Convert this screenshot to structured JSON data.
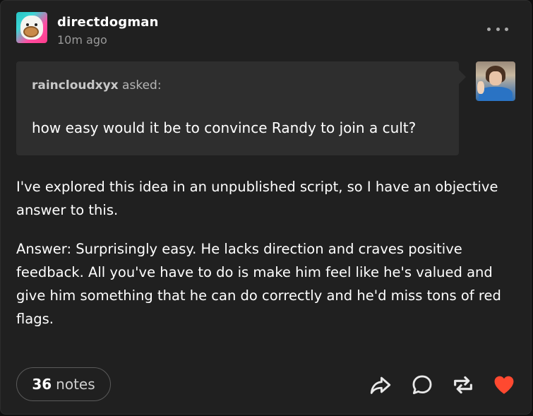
{
  "post": {
    "username": "directdogman",
    "timestamp": "10m ago",
    "ask": {
      "asker": "raincloudxyx",
      "asked_suffix": " asked:",
      "question": "how easy would it be to convince Randy to join a cult?"
    },
    "paragraphs": [
      "I've explored this idea in an unpublished script, so I have an objective answer to this.",
      "Answer: Surprisingly easy. He lacks direction and craves positive feedback. All you've have to do is make him feel like he's valued and give him something that he can do correctly and he'd miss tons of red flags."
    ],
    "notes": {
      "count": "36",
      "label": "notes"
    }
  },
  "icons": {
    "more": "more-dots-icon",
    "share": "share-arrow-icon",
    "reply": "reply-bubble-icon",
    "reblog": "reblog-icon",
    "like": "heart-icon"
  },
  "colors": {
    "post_bg": "#202020",
    "ask_bg": "#2e2e2e",
    "like_red": "#ff4930",
    "muted_text": "#9a9a9a"
  }
}
